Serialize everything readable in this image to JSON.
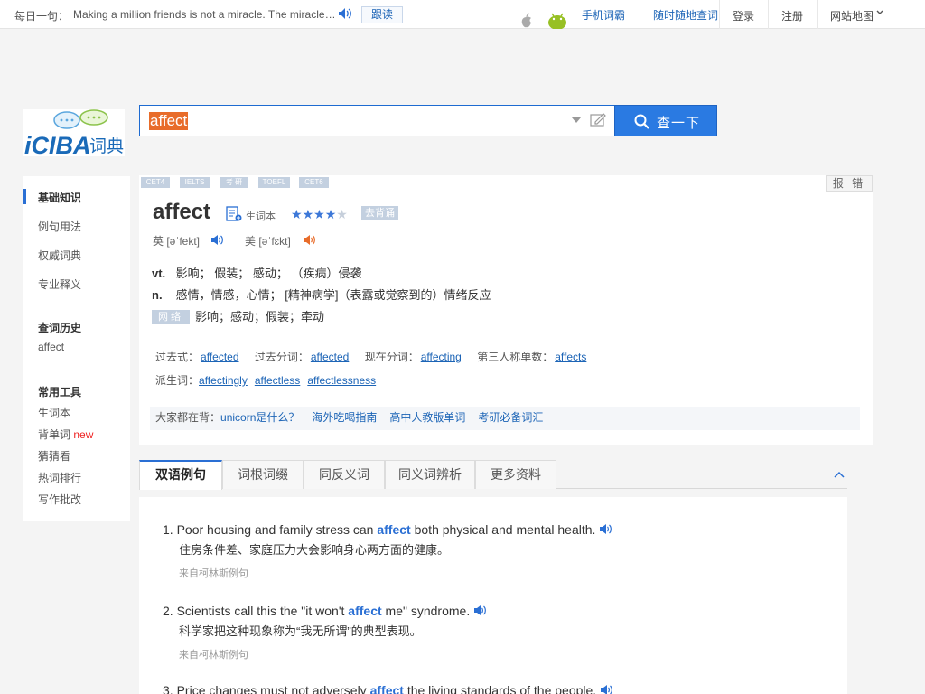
{
  "topbar": {
    "daily_label": "每日一句：",
    "daily_sentence": "Making a million friends is not a miracle. The miracle is to make a friend who will stand by you when millions are against you.",
    "follow_label": "跟读",
    "mobile_link": "手机词霸",
    "mobile_tag": "随时随地查词",
    "login": "登录",
    "register": "注册",
    "sitemap": "网站地图"
  },
  "logo": {
    "brand": "iCIBA",
    "suffix": "词典"
  },
  "search": {
    "value": "affect",
    "button_label": "查一下"
  },
  "sidebar": {
    "sections": [
      {
        "items": [
          "基础知识",
          "例句用法",
          "权威词典",
          "专业释义"
        ]
      }
    ],
    "history_title": "查词历史",
    "history_items": [
      "affect"
    ],
    "tools_title": "常用工具",
    "tools": [
      "生词本",
      "背单词",
      "猜猜看",
      "热词排行",
      "写作批改"
    ],
    "new_badge": "new"
  },
  "entry": {
    "exam_tags": [
      "CET4",
      "IELTS",
      "考 研",
      "TOEFL",
      "CET6"
    ],
    "report_label": "报 错",
    "word": "affect",
    "wordbook_label": "生词本",
    "stars_on": 4,
    "stars_total": 5,
    "star_glyphs": [
      "★",
      "★",
      "★",
      "★",
      "★"
    ],
    "stars_label": "去背诵",
    "phonetics": [
      {
        "label": "英 [əˈfekt]"
      },
      {
        "label": "美 [əˈfɛkt]"
      }
    ],
    "definitions": [
      {
        "pos": "vt.",
        "text": "影响；  假装；  感动；  （疾病）侵袭"
      },
      {
        "pos": "n.",
        "text": "感情，情感，心情；  [精神病学]（表露或觉察到的）情绪反应"
      }
    ],
    "network_tag": "网络",
    "network_text": "影响；感动；假装；牵动",
    "forms_row1": [
      {
        "label": "过去式：",
        "value": "affected"
      },
      {
        "label": "过去分词：",
        "value": "affected"
      },
      {
        "label": "现在分词：",
        "value": "affecting"
      },
      {
        "label": "第三人称单数：",
        "value": "affects"
      }
    ],
    "derived_label": "派生词：",
    "derived": [
      "affectingly",
      "affectless",
      "affectlessness"
    ],
    "recite_label": "大家都在背：",
    "recite_links": [
      "unicorn是什么？",
      "海外吃喝指南",
      "高中人教版单词",
      "考研必备词汇"
    ]
  },
  "tabs": [
    "双语例句",
    "词根词缀",
    "同反义词",
    "同义词辨析",
    "更多资料"
  ],
  "examples": [
    {
      "num": "1.",
      "before": "Poor housing and family stress can ",
      "word": "affect",
      "after": " both physical and mental health.",
      "zh": "住房条件差、家庭压力大会影响身心两方面的健康。",
      "source": "来自柯林斯例句"
    },
    {
      "num": "2.",
      "before": "Scientists call this the \"it won't ",
      "word": "affect",
      "after": " me\" syndrome.",
      "zh": "科学家把这种现象称为“我无所谓”的典型表现。",
      "source": "来自柯林斯例句"
    },
    {
      "num": "3.",
      "before": "Price changes must not adversely ",
      "word": "affect",
      "after": " the living standards of the people.",
      "zh": "",
      "source": ""
    }
  ],
  "colors": {
    "accent": "#2a7ae2",
    "highlight": "#e86c2a",
    "tag": "#c3d0e0"
  }
}
